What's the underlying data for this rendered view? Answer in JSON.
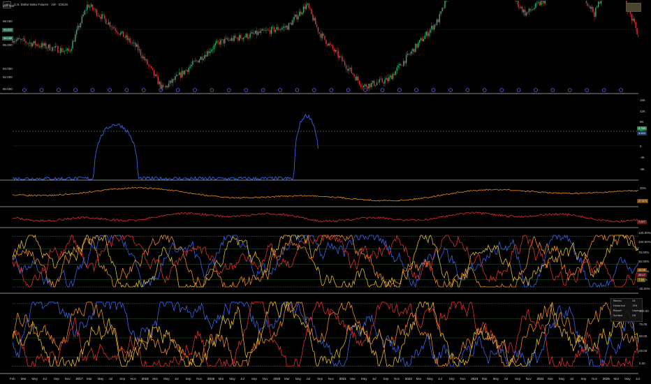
{
  "header": {
    "symbol": "USD",
    "title": "U.S. Dollar Index Futures · 1W · ICEUS"
  },
  "colors": {
    "background": "#000000",
    "up_candle": "#2fb36b",
    "down_candle": "#e0303a",
    "blue_line": "#3b63e6",
    "orange_line": "#f08a1e",
    "red_line": "#e03030",
    "gold_line": "#e6b82a",
    "divider": "#c8c8c8",
    "event_marker": "#6b5cf0"
  },
  "price_axis": {
    "ticks": [
      "102.000",
      "98.000",
      "96.000",
      "94.000",
      "92.000",
      "90.000"
    ],
    "badge_values": [
      "99.620",
      "98.180"
    ]
  },
  "panels": {
    "cot": {
      "ticks": [
        "16K",
        "12K",
        "8K",
        "4K",
        "0",
        "-4K",
        "-8K"
      ],
      "badge_values": [
        "5.784",
        "4.624"
      ]
    },
    "orange_osc": {
      "ticks": [
        "40%"
      ],
      "badge_value": "27.674"
    },
    "red_osc": {
      "badge_value": "7.677"
    },
    "index_a": {
      "ticks": [
        "125.00%",
        "100.00%",
        "75.00%",
        "50.00%",
        "25.00%",
        "0.00%",
        "-25.00%"
      ],
      "badge_values": [
        "40.35",
        "25.17",
        "7.18"
      ]
    },
    "index_b": {
      "ticks": [
        "100.00",
        "75.00",
        "50.00",
        "25.00",
        "0.00"
      ]
    }
  },
  "legend": {
    "rows": [
      {
        "label": "Weeks",
        "value": "26"
      },
      {
        "label": "Historical",
        "value": "156"
      },
      {
        "label": "Report",
        "value": "Legacy"
      },
      {
        "label": "Symbol",
        "value": "DX"
      }
    ]
  },
  "time_axis": {
    "labels": [
      "Feb",
      "Mar",
      "May",
      "Jul",
      "Sep",
      "Nov",
      "2017",
      "Mar",
      "May",
      "Jul",
      "Sep",
      "Nov",
      "2018",
      "Mar",
      "May",
      "Jul",
      "Sep",
      "Nov",
      "2019",
      "Mar",
      "May",
      "Jul",
      "Sep",
      "Nov",
      "2020",
      "Mar",
      "May",
      "Jul",
      "Sep",
      "Nov",
      "2021",
      "Mar",
      "May",
      "Jul",
      "Sep",
      "Nov",
      "2022",
      "Mar",
      "May",
      "Jul",
      "Sep",
      "Nov",
      "2023",
      "Mar",
      "May",
      "Jul",
      "Sep",
      "Nov",
      "2024",
      "Mar",
      "May",
      "Jul",
      "Sep",
      "Nov",
      "2025",
      "Mar",
      "May",
      "Jul"
    ]
  },
  "chart_data": {
    "type": "line",
    "note_series": [
      {
        "name": "U.S. Dollar Index Futures",
        "type": "candlestick",
        "x": [
          "2016-02",
          "2016-08",
          "2016-12",
          "2017-06",
          "2018-02",
          "2018-10",
          "2019-10",
          "2020-03",
          "2020-05",
          "2021-01",
          "2021-06",
          "2022-04",
          "2022-09",
          "2023-01",
          "2023-07",
          "2024-01",
          "2024-06",
          "2024-09",
          "2025-01",
          "2025-03",
          "2025-07"
        ],
        "close": [
          97.0,
          95.0,
          102.5,
          95.5,
          89.0,
          96.5,
          99.0,
          102.5,
          98.0,
          90.0,
          90.5,
          100.0,
          113.0,
          102.0,
          101.0,
          104.0,
          106.0,
          101.0,
          109.0,
          104.0,
          97.5
        ]
      }
    ]
  }
}
